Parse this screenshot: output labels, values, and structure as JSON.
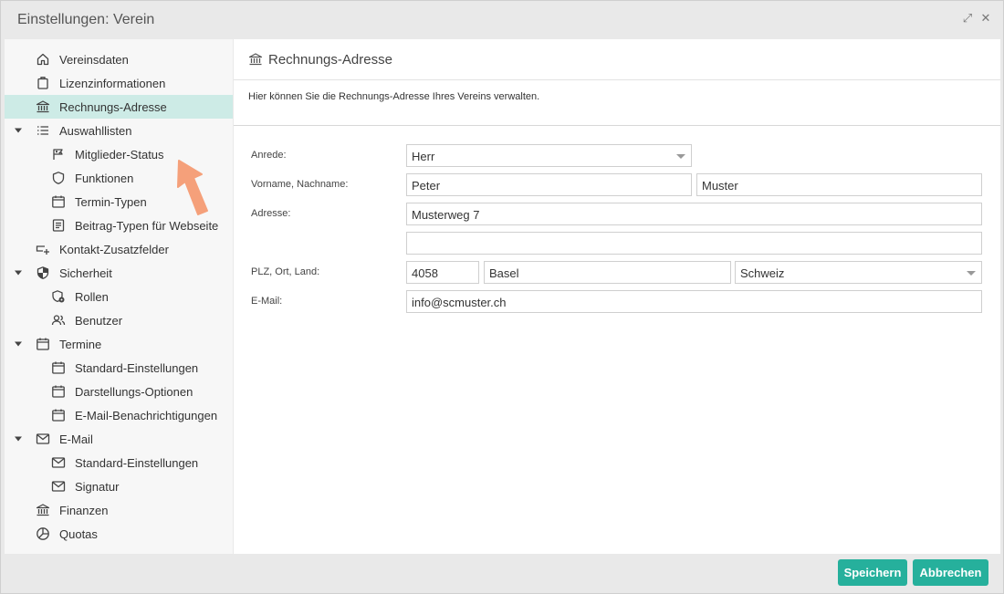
{
  "window": {
    "title": "Einstellungen: Verein",
    "expand_glyph": "⤢",
    "close_glyph": "✕"
  },
  "sidebar": {
    "items": [
      {
        "label": "Vereinsdaten",
        "icon": "home-icon"
      },
      {
        "label": "Lizenzinformationen",
        "icon": "clipboard-icon"
      },
      {
        "label": "Rechnungs-Adresse",
        "icon": "bank-icon",
        "selected": true
      },
      {
        "label": "Auswahllisten",
        "icon": "list-icon",
        "expanded": true
      },
      {
        "label": "Mitglieder-Status",
        "icon": "flag-icon"
      },
      {
        "label": "Funktionen",
        "icon": "shield-outline-icon"
      },
      {
        "label": "Termin-Typen",
        "icon": "calendar-icon"
      },
      {
        "label": "Beitrag-Typen für Webseite",
        "icon": "document-icon"
      },
      {
        "label": "Kontakt-Zusatzfelder",
        "icon": "field-add-icon"
      },
      {
        "label": "Sicherheit",
        "icon": "security-shield-icon",
        "expanded": true
      },
      {
        "label": "Rollen",
        "icon": "role-shield-icon"
      },
      {
        "label": "Benutzer",
        "icon": "users-icon"
      },
      {
        "label": "Termine",
        "icon": "calendar-icon",
        "expanded": true
      },
      {
        "label": "Standard-Einstellungen",
        "icon": "calendar-icon"
      },
      {
        "label": "Darstellungs-Optionen",
        "icon": "calendar-icon"
      },
      {
        "label": "E-Mail-Benachrichtigungen",
        "icon": "calendar-icon"
      },
      {
        "label": "E-Mail",
        "icon": "mail-icon",
        "expanded": true
      },
      {
        "label": "Standard-Einstellungen",
        "icon": "mail-icon"
      },
      {
        "label": "Signatur",
        "icon": "mail-icon"
      },
      {
        "label": "Finanzen",
        "icon": "bank-icon"
      },
      {
        "label": "Quotas",
        "icon": "pie-chart-icon"
      }
    ]
  },
  "main": {
    "heading": "Rechnungs-Adresse",
    "description": "Hier können Sie die Rechnungs-Adresse Ihres Vereins verwalten.",
    "labels": {
      "anrede": "Anrede:",
      "name": "Vorname, Nachname:",
      "adresse": "Adresse:",
      "plz_ort_land": "PLZ, Ort, Land:",
      "email": "E-Mail:"
    },
    "values": {
      "anrede": "Herr",
      "vorname": "Peter",
      "nachname": "Muster",
      "adresse1": "Musterweg 7",
      "adresse2": "",
      "plz": "4058",
      "ort": "Basel",
      "land": "Schweiz",
      "email": "info@scmuster.ch"
    }
  },
  "buttons": {
    "save": "Speichern",
    "cancel": "Abbrechen"
  },
  "colors": {
    "accent": "#26b09c",
    "selected_bg": "#cdebe6",
    "arrow": "#f5a07a"
  }
}
